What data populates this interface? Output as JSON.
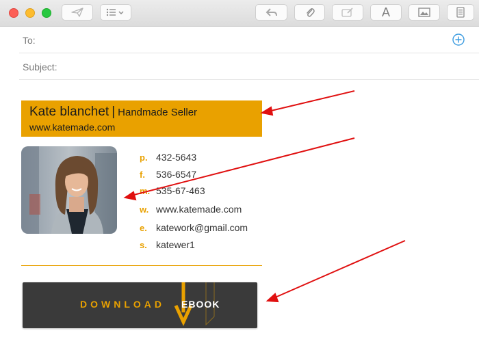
{
  "toolbar": {
    "icons": [
      "send-icon",
      "list-options-icon",
      "reply-icon",
      "attachment-icon",
      "markup-icon",
      "font-icon",
      "photo-browser-icon",
      "format-icon"
    ],
    "font_glyph": "A"
  },
  "header": {
    "to_label": "To:",
    "subject_label": "Subject:"
  },
  "signature": {
    "name": "Kate blanchet",
    "separator": "|",
    "role": "Handmade Seller",
    "website": "www.katemade.com",
    "accent_color": "#e9a100",
    "contacts": [
      {
        "key": "p.",
        "value": "432-5643"
      },
      {
        "key": "f.",
        "value": "536-6547"
      },
      {
        "key": "m.",
        "value": "535-67-463"
      },
      {
        "key": "w.",
        "value": "www.katemade.com"
      },
      {
        "key": "e.",
        "value": "katework@gmail.com"
      },
      {
        "key": "s.",
        "value": "katewer1"
      }
    ]
  },
  "ebook": {
    "download_label": "DOWNLOAD",
    "ebook_label": "EBOOK"
  },
  "annotations": {
    "arrow_color": "#e01010"
  }
}
